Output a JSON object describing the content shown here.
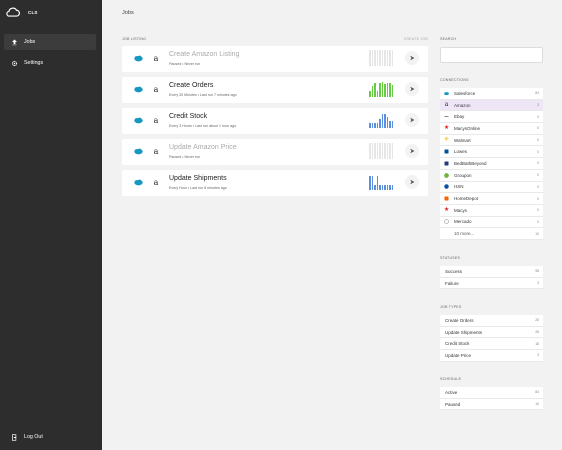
{
  "brand": {
    "label": "CLS"
  },
  "nav": [
    {
      "label": "Jobs",
      "icon": "upload-icon"
    },
    {
      "label": "Settings",
      "icon": "gear-icon"
    }
  ],
  "logout": {
    "label": "Log Out",
    "icon": "logout-icon"
  },
  "page": {
    "title": "Jobs",
    "listing_label": "JOB LISTING",
    "create_label": "CREATE JOB"
  },
  "jobs": [
    {
      "name": "Create Amazon Listing",
      "meta": "Paused • Never run",
      "paused": true,
      "bars": [
        0,
        0,
        0,
        0,
        0,
        0,
        0,
        0,
        0,
        0
      ],
      "bar_color": "#e6e6e6"
    },
    {
      "name": "Create Orders",
      "meta": "Every 30 Minutes • Last run 7 minutes ago",
      "paused": false,
      "bars": [
        0.35,
        0.7,
        0.9,
        0.4,
        0.9,
        0.95,
        0.8,
        0.9,
        0.85,
        0.75
      ],
      "bar_color": "#66cc44"
    },
    {
      "name": "Credit Stock",
      "meta": "Every 3 Hours • Last run about 1 hour ago",
      "paused": false,
      "bars": [
        0.3,
        0.3,
        0.3,
        0.3,
        0.55,
        0.9,
        0.85,
        0.7,
        0.45,
        0.45
      ],
      "bar_color": "#5b8fe0"
    },
    {
      "name": "Update Amazon Price",
      "meta": "Paused • Never run",
      "paused": true,
      "bars": [
        0,
        0,
        0,
        0,
        0,
        0,
        0,
        0,
        0,
        0
      ],
      "bar_color": "#e6e6e6"
    },
    {
      "name": "Update Shipments",
      "meta": "Every Hour • Last run 8 minutes ago",
      "paused": false,
      "bars": [
        0.9,
        0.85,
        0.3,
        0.85,
        0.3,
        0.3,
        0.3,
        0.3,
        0.3,
        0.3
      ],
      "bar_color": "#5b8fe0"
    }
  ],
  "search": {
    "label": "SEARCH",
    "value": "",
    "placeholder": ""
  },
  "connections": {
    "label": "CONNECTIONS",
    "items": [
      {
        "name": "Salesforce",
        "count": "84",
        "icon": "salesforce-icon",
        "color": "#1798c1",
        "selected": false
      },
      {
        "name": "Amazon",
        "count": "3",
        "icon": "amazon-icon",
        "color": "#222",
        "selected": true
      },
      {
        "name": "Ebay",
        "count": "0",
        "icon": "ebay-icon",
        "color": "#888",
        "selected": false
      },
      {
        "name": "MacysOnline",
        "count": "0",
        "icon": "star-icon",
        "color": "#d22",
        "selected": false
      },
      {
        "name": "Walmart",
        "count": "0",
        "icon": "walmart-icon",
        "color": "#f5b400",
        "selected": false
      },
      {
        "name": "Lowes",
        "count": "0",
        "icon": "lowes-icon",
        "color": "#00549a",
        "selected": false
      },
      {
        "name": "BedBathBeyond",
        "count": "0",
        "icon": "bedbathbeyond-icon",
        "color": "#1f3d7a",
        "selected": false
      },
      {
        "name": "Groupon",
        "count": "0",
        "icon": "groupon-icon",
        "color": "#53a318",
        "selected": false
      },
      {
        "name": "HSN",
        "count": "0",
        "icon": "hsn-icon",
        "color": "#0a52a5",
        "selected": false
      },
      {
        "name": "HomeDepot",
        "count": "0",
        "icon": "homedepot-icon",
        "color": "#f96302",
        "selected": false
      },
      {
        "name": "Macys",
        "count": "0",
        "icon": "star-icon",
        "color": "#d22",
        "selected": false
      },
      {
        "name": "Mercado",
        "count": "0",
        "icon": "mercado-icon",
        "color": "#888",
        "selected": false
      }
    ],
    "more": {
      "label": "10 more...",
      "count": "10"
    }
  },
  "statuses": {
    "label": "STATUSES",
    "items": [
      {
        "name": "Success",
        "count": "98"
      },
      {
        "name": "Failure",
        "count": "3"
      }
    ]
  },
  "job_types": {
    "label": "JOB TYPES",
    "items": [
      {
        "name": "Create Orders",
        "count": "28"
      },
      {
        "name": "Update Shipments",
        "count": "26"
      },
      {
        "name": "Credit Stock",
        "count": "18"
      },
      {
        "name": "Update Price",
        "count": "3"
      }
    ]
  },
  "schedule": {
    "label": "SCHEDULE",
    "items": [
      {
        "name": "Active",
        "count": "84"
      },
      {
        "name": "Paused",
        "count": "10"
      }
    ]
  }
}
